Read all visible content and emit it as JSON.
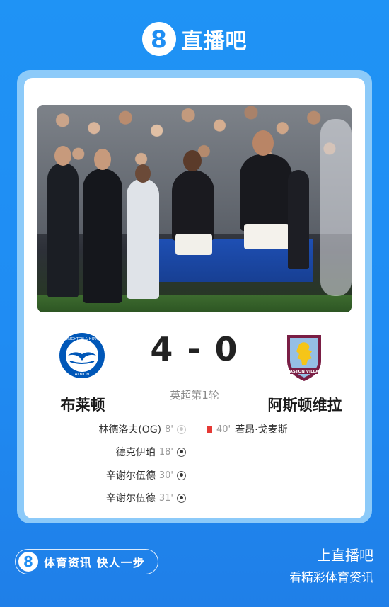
{
  "brand": {
    "logo_glyph": "8",
    "name": "直播吧"
  },
  "match": {
    "home_team": "布莱顿",
    "away_team": "阿斯顿维拉",
    "score": "4 - 0",
    "round": "英超第1轮",
    "home_crest_text_top": "BRIGHTON & HOVE",
    "home_crest_text_bottom": "ALBION",
    "away_crest_text": "ASTON VILLA"
  },
  "events": {
    "home": [
      {
        "player": "林德洛夫(OG)",
        "minute": "8'",
        "icon": "own-goal-icon"
      },
      {
        "player": "德克伊珀",
        "minute": "18'",
        "icon": "goal-ball-icon"
      },
      {
        "player": "辛谢尔伍德",
        "minute": "30'",
        "icon": "goal-ball-icon"
      },
      {
        "player": "辛谢尔伍德",
        "minute": "31'",
        "icon": "goal-ball-icon"
      }
    ],
    "away": [
      {
        "player": "若昂·戈麦斯",
        "minute": "40'",
        "icon": "red-card-icon"
      }
    ]
  },
  "footer": {
    "pill_logo": "8",
    "slogan": "体育资讯 快人一步",
    "right_line1": "上直播吧",
    "right_line2": "看精彩体育资讯"
  },
  "colors": {
    "background": "#1f8ef3",
    "card_frame": "#8ccaf9",
    "red_card": "#e53935",
    "brighton_blue": "#0057b8",
    "villa_claret": "#7a1e45",
    "villa_sky": "#95bfe5"
  }
}
